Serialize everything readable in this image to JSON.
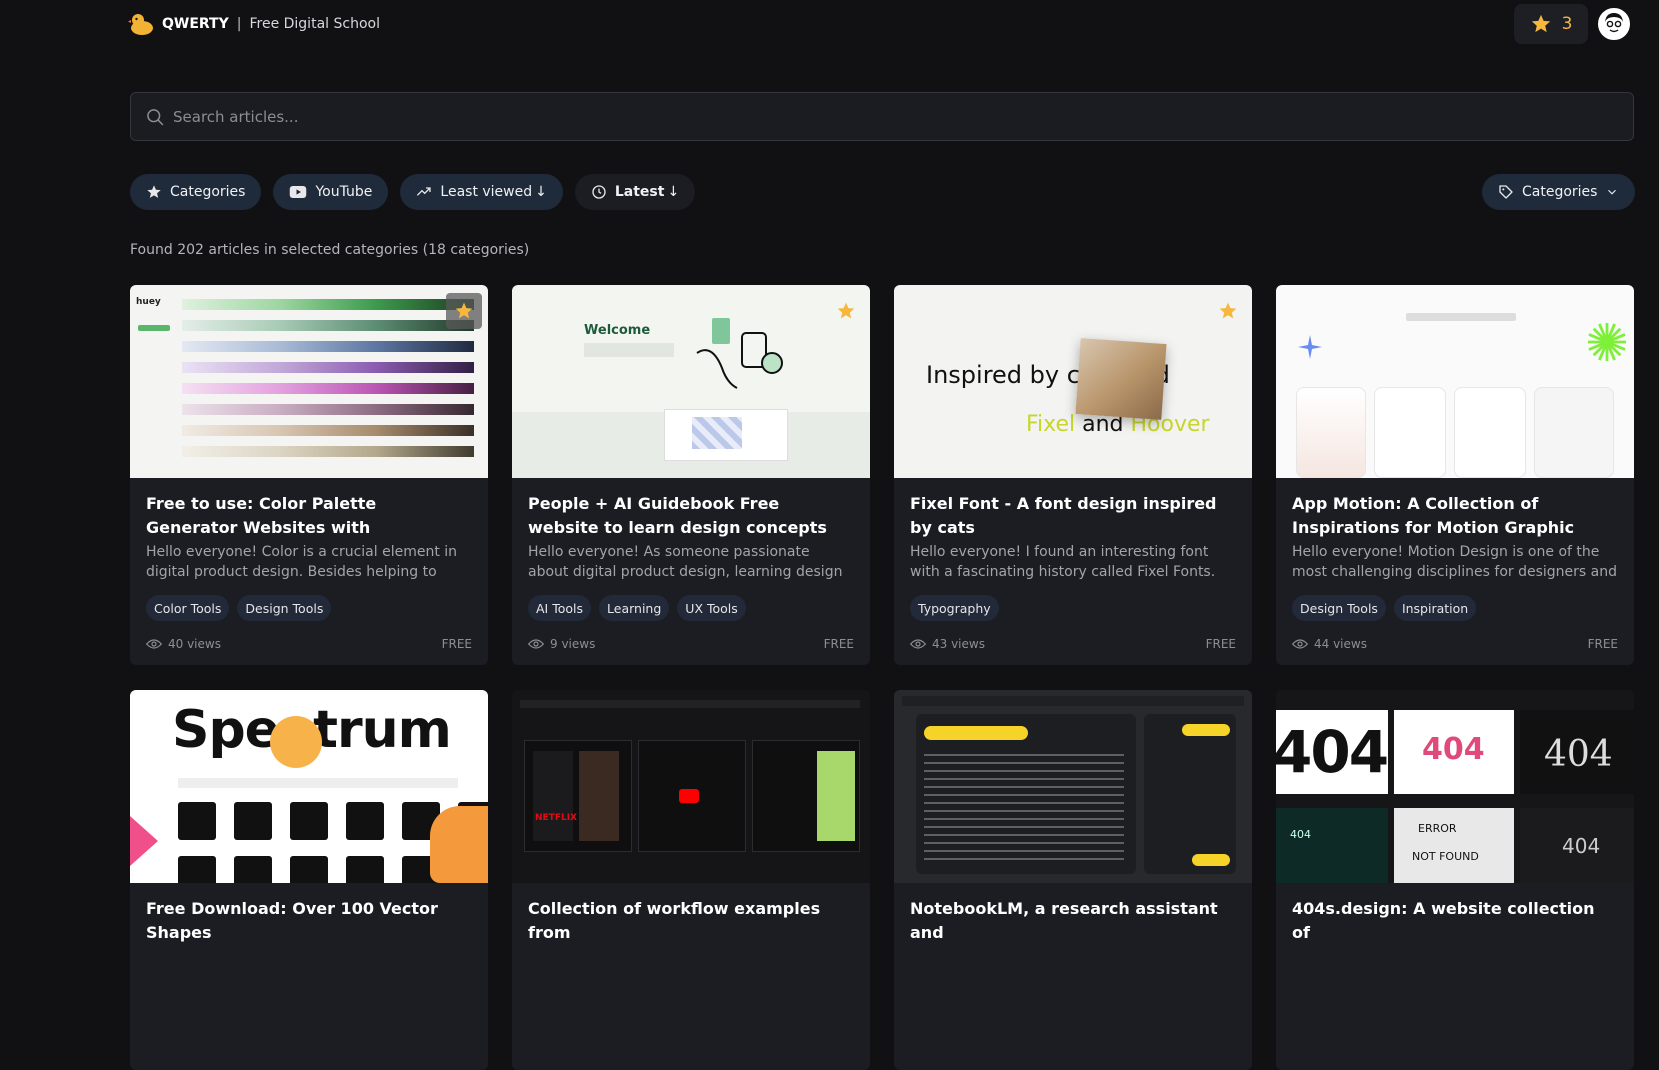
{
  "brand": {
    "name": "QWERTY",
    "separator": "|",
    "tagline": "Free Digital School"
  },
  "header": {
    "points": "3"
  },
  "search": {
    "placeholder": "Search articles..."
  },
  "filters": {
    "categories": "Categories",
    "youtube": "YouTube",
    "least_viewed": "Least viewed",
    "latest": "Latest",
    "arrow": "↓",
    "dropdown": "Categories"
  },
  "summary": "Found 202 articles in selected categories (18 categories)",
  "cards": [
    {
      "title": "Free to use: Color Palette Generator Websites with Development Code",
      "desc": "Hello everyone! Color is a crucial element in digital product design. Besides helping to defin...",
      "tags": [
        "Color Tools",
        "Design Tools"
      ],
      "views": "40 views",
      "price": "FREE",
      "starred": true,
      "thumb_text": "huey"
    },
    {
      "title": "People + AI Guidebook Free website to learn design concepts with Google",
      "desc": "Hello everyone! As someone passionate about digital product design, learning design concept...",
      "tags": [
        "AI Tools",
        "Learning",
        "UX Tools"
      ],
      "views": "9 views",
      "price": "FREE",
      "starred": true,
      "thumb_text": "Welcome"
    },
    {
      "title": "Fixel Font - A font design inspired by cats",
      "desc": "Hello everyone! I found an interesting font with a fascinating history called Fixel Fonts. Fixel Fonts...",
      "tags": [
        "Typography"
      ],
      "views": "43 views",
      "price": "FREE",
      "starred": true,
      "thumb_text": "Inspired by c      ved",
      "thumb_text2": "Fixel",
      "thumb_text3": "and",
      "thumb_text4": "Hoover"
    },
    {
      "title": "App Motion: A Collection of Inspirations for Motion Graphic Design",
      "desc": "Hello everyone! Motion Design is one of the most challenging disciplines for designers and digital...",
      "tags": [
        "Design Tools",
        "Inspiration"
      ],
      "views": "44 views",
      "price": "FREE",
      "starred": false
    },
    {
      "title": "Free Download: Over 100 Vector Shapes",
      "thumb_text": "Spe  trum"
    },
    {
      "title": "Collection of workflow examples from",
      "thumb_text": "NETFLIX"
    },
    {
      "title": "NotebookLM, a research assistant and"
    },
    {
      "title": "404s.design: A website collection of",
      "thumb_text": "404",
      "thumb_text2": "ERROR",
      "thumb_text3": "NOT FOUND"
    }
  ],
  "colors": {
    "accent_star": "#f6b73c",
    "chip_bg": "#1f2a3a",
    "card_bg": "#1c1d23",
    "page_bg": "#111113"
  }
}
